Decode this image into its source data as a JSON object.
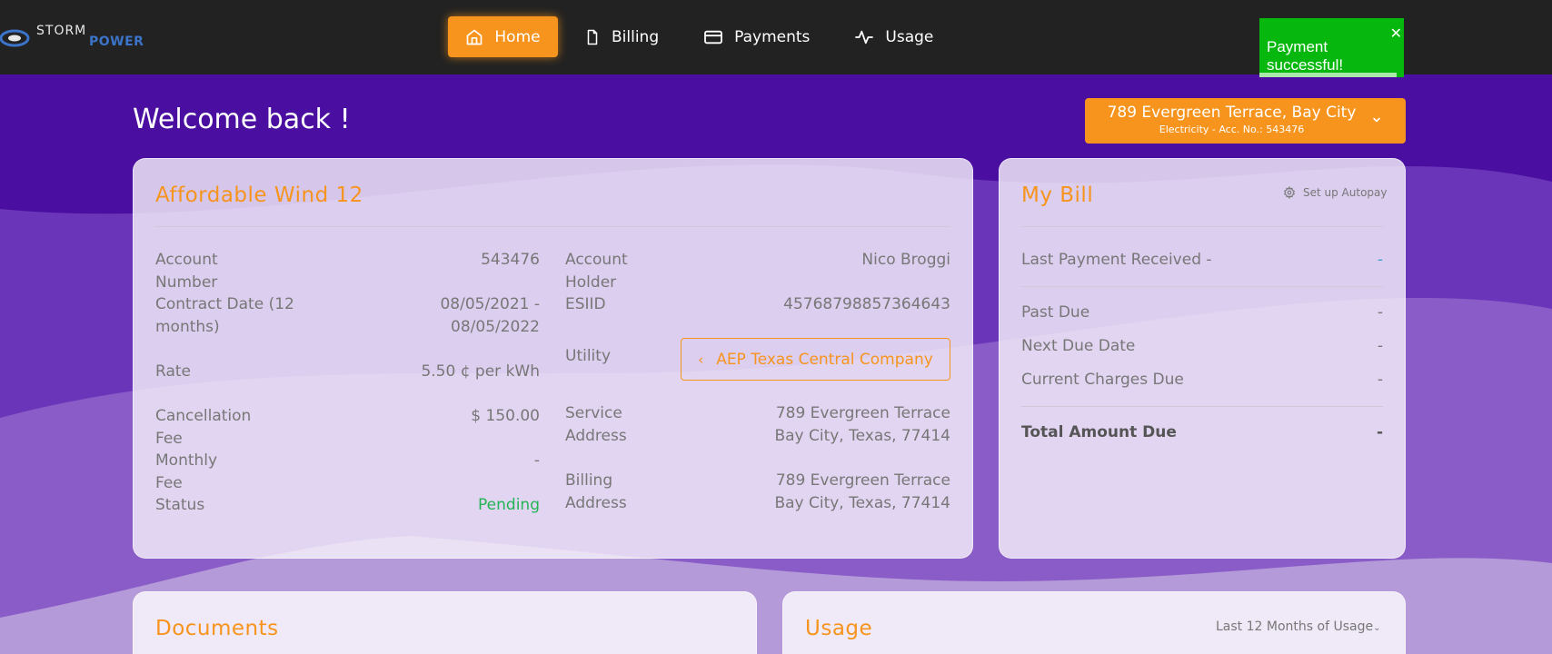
{
  "brand": {
    "logo_top": "STORM",
    "logo_bottom": "POWER"
  },
  "nav": {
    "items": [
      {
        "label": "Home",
        "icon": "home-icon",
        "active": true
      },
      {
        "label": "Billing",
        "icon": "file-icon",
        "active": false
      },
      {
        "label": "Payments",
        "icon": "credit-card-icon",
        "active": false
      },
      {
        "label": "Usage",
        "icon": "activity-icon",
        "active": false
      }
    ]
  },
  "toast": {
    "message": "Payment successful!",
    "close": "✕",
    "progress": 0.95
  },
  "header": {
    "welcome": "Welcome back !",
    "account_select": {
      "address": "789 Evergreen Terrace, Bay City",
      "subtitle": "Electricity - Acc. No.: 543476"
    }
  },
  "plan_card": {
    "title": "Affordable Wind 12",
    "left": [
      {
        "label": "Account Number",
        "value": "543476"
      },
      {
        "label": "Contract Date (12 months)",
        "value": "08/05/2021 - 08/05/2022"
      },
      {
        "label": "Rate",
        "value": "5.50 ¢ per kWh"
      },
      {
        "label": "Cancellation Fee",
        "value": "$ 150.00"
      },
      {
        "label": "Monthly Fee",
        "value": "-"
      },
      {
        "label": "Status",
        "value": "Pending"
      }
    ],
    "right": {
      "account_holder": {
        "label": "Account Holder",
        "value": "Nico Broggi"
      },
      "esiid": {
        "label": "ESIID",
        "value": "45768798857364643"
      },
      "utility": {
        "label": "Utility",
        "value": "AEP Texas Central Company"
      },
      "service_address": {
        "label": "Service Address",
        "line1": "789 Evergreen Terrace",
        "line2": "Bay City, Texas, 77414"
      },
      "billing_address": {
        "label": "Billing Address",
        "line1": "789 Evergreen Terrace",
        "line2": "Bay City, Texas, 77414"
      }
    }
  },
  "bill_card": {
    "title": "My Bill",
    "autopay_label": "Set up Autopay",
    "last_payment": {
      "label": "Last Payment Received -",
      "value": "-"
    },
    "rows": [
      {
        "label": "Past Due",
        "value": "-"
      },
      {
        "label": "Next Due Date",
        "value": "-"
      },
      {
        "label": "Current Charges Due",
        "value": "-"
      }
    ],
    "total": {
      "label": "Total Amount Due",
      "value": "-"
    }
  },
  "documents_card": {
    "title": "Documents"
  },
  "usage_card": {
    "title": "Usage",
    "filter": "Last 12 Months of Usage"
  },
  "colors": {
    "accent": "#f7941d",
    "background": "#4a0ea0",
    "nav": "#222222",
    "success": "#06b80e",
    "status_green": "#22b455"
  }
}
